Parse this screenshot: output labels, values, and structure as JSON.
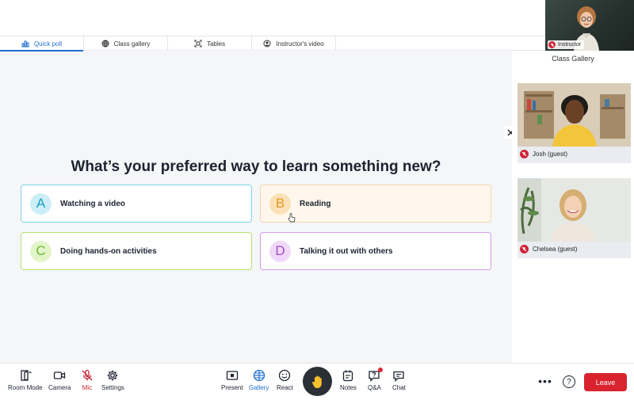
{
  "tabs": [
    {
      "label": "Quick poll",
      "icon": "bar-chart-icon",
      "active": true
    },
    {
      "label": "Class gallery",
      "icon": "grid-globe-icon",
      "active": false
    },
    {
      "label": "Tables",
      "icon": "expand-frame-icon",
      "active": false
    },
    {
      "label": "Instructor's video",
      "icon": "user-circle-icon",
      "active": false
    }
  ],
  "instructor": {
    "label": "Instructor",
    "muted": true
  },
  "poll": {
    "question": "What’s your preferred way to learn something new?",
    "options": [
      {
        "letter": "A",
        "text": "Watching a video",
        "color": "#1a9ec4"
      },
      {
        "letter": "B",
        "text": "Reading",
        "color": "#e39a1f"
      },
      {
        "letter": "C",
        "text": "Doing hands-on activities",
        "color": "#6bb82b"
      },
      {
        "letter": "D",
        "text": "Talking it out with others",
        "color": "#a34cc8"
      }
    ]
  },
  "gallery": {
    "title": "Class Gallery",
    "participants": [
      {
        "name": "Josh (guest)",
        "muted": true
      },
      {
        "name": "Chelsea (guest)",
        "muted": true
      }
    ]
  },
  "toolbar": {
    "room_mode": "Room Mode",
    "camera": "Camera",
    "mic": "Mic",
    "settings": "Settings",
    "present": "Present",
    "gallery": "Gallery",
    "react": "React",
    "notes": "Notes",
    "qa": "Q&A",
    "chat": "Chat",
    "leave": "Leave",
    "more": "•••",
    "help": "?"
  },
  "colors": {
    "accent": "#1f6fd1",
    "leave": "#d9232f",
    "mute": "#d0243a"
  }
}
